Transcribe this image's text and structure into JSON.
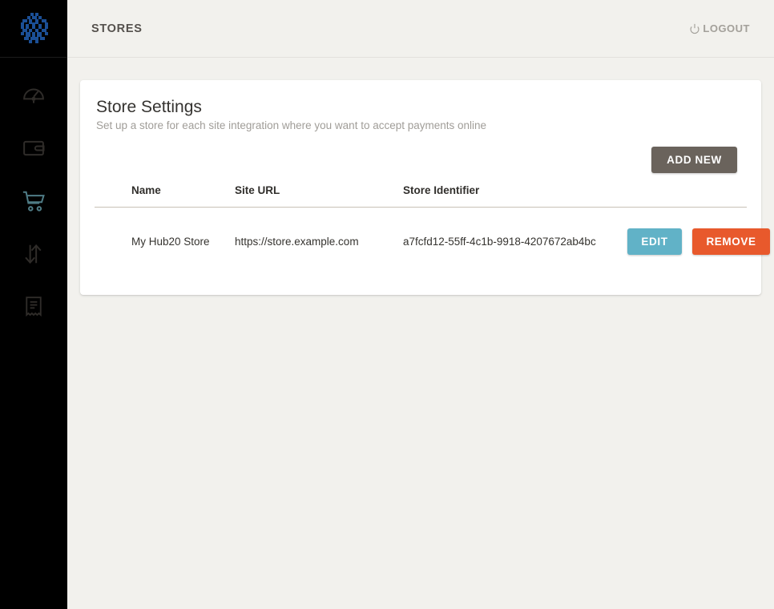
{
  "sidebar": {
    "logo": {
      "icon": "hub20-pixel-globe-logo",
      "color": "#1b4f96"
    },
    "items": [
      {
        "icon": "dashboard-gauge-icon",
        "label": "Dashboard",
        "active": false
      },
      {
        "icon": "wallet-icon",
        "label": "Wallet",
        "active": false
      },
      {
        "icon": "shopping-cart-icon",
        "label": "Stores",
        "active": true
      },
      {
        "icon": "transfer-arrows-icon",
        "label": "Transfers",
        "active": false
      },
      {
        "icon": "receipt-icon",
        "label": "Invoices",
        "active": false
      }
    ]
  },
  "topbar": {
    "title": "STORES",
    "logout_label": "LOGOUT",
    "logout_icon": "power-icon"
  },
  "card": {
    "title": "Store Settings",
    "subtitle": "Set up a store for each site integration where you want to accept payments online",
    "add_new_label": "ADD NEW"
  },
  "table": {
    "columns": [
      "Name",
      "Site URL",
      "Store Identifier",
      ""
    ],
    "rows": [
      {
        "name": "My Hub20 Store",
        "site_url": "https://store.example.com",
        "store_identifier": "a7fcfd12-55ff-4c1b-9918-4207672ab4bc",
        "edit_label": "EDIT",
        "remove_label": "REMOVE"
      }
    ]
  },
  "colors": {
    "page_background": "#f2f1ed",
    "sidebar_background": "#000000",
    "card_background": "#ffffff",
    "accent_active": "#4f7c86",
    "button_add": "#6a635c",
    "button_edit": "#61b2c7",
    "button_remove": "#e8592c",
    "logo_blue": "#1b4f96",
    "divider": "#c8c1b6"
  }
}
